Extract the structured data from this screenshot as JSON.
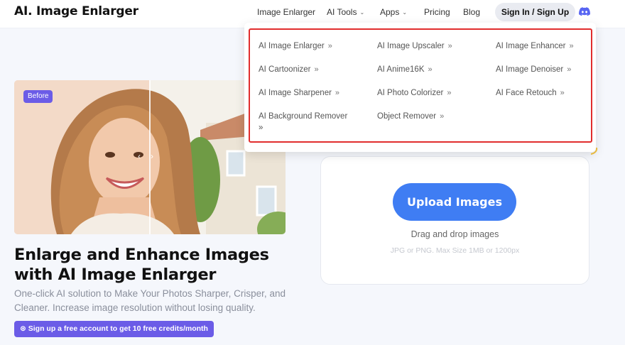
{
  "header": {
    "logo": "AI. Image Enlarger",
    "nav": {
      "image_enlarger": "Image Enlarger",
      "ai_tools": "AI Tools",
      "apps": "Apps",
      "pricing": "Pricing",
      "blog": "Blog"
    },
    "signin": "Sign In / Sign Up"
  },
  "dropdown": {
    "arrow": "»",
    "items": [
      "AI Image Enlarger",
      "AI Image Upscaler",
      "AI Image Enhancer",
      "AI Cartoonizer",
      "AI Anime16K",
      "AI Image Denoiser",
      "AI Image Sharpener",
      "AI Photo Colorizer",
      "AI Face Retouch",
      "AI Background Remover",
      "Object Remover"
    ]
  },
  "hero": {
    "badge": "Before",
    "title": "Enlarge and Enhance Images with AI Image Enlarger",
    "subtitle": "One-click AI solution to Make Your Photos Sharper, Crisper, and Cleaner. Increase image resolution without losing quality.",
    "cta": "Sign up a free account to get 10 free credits/month",
    "cta_icon": "⊛"
  },
  "upload": {
    "button": "Upload Images",
    "drag": "Drag and drop images",
    "limits": "JPG or PNG. Max Size 1MB or 1200px"
  },
  "colors": {
    "accent_purple": "#6b5ce7",
    "upload_blue": "#3f7df3",
    "highlight_red": "#e12d2d"
  }
}
